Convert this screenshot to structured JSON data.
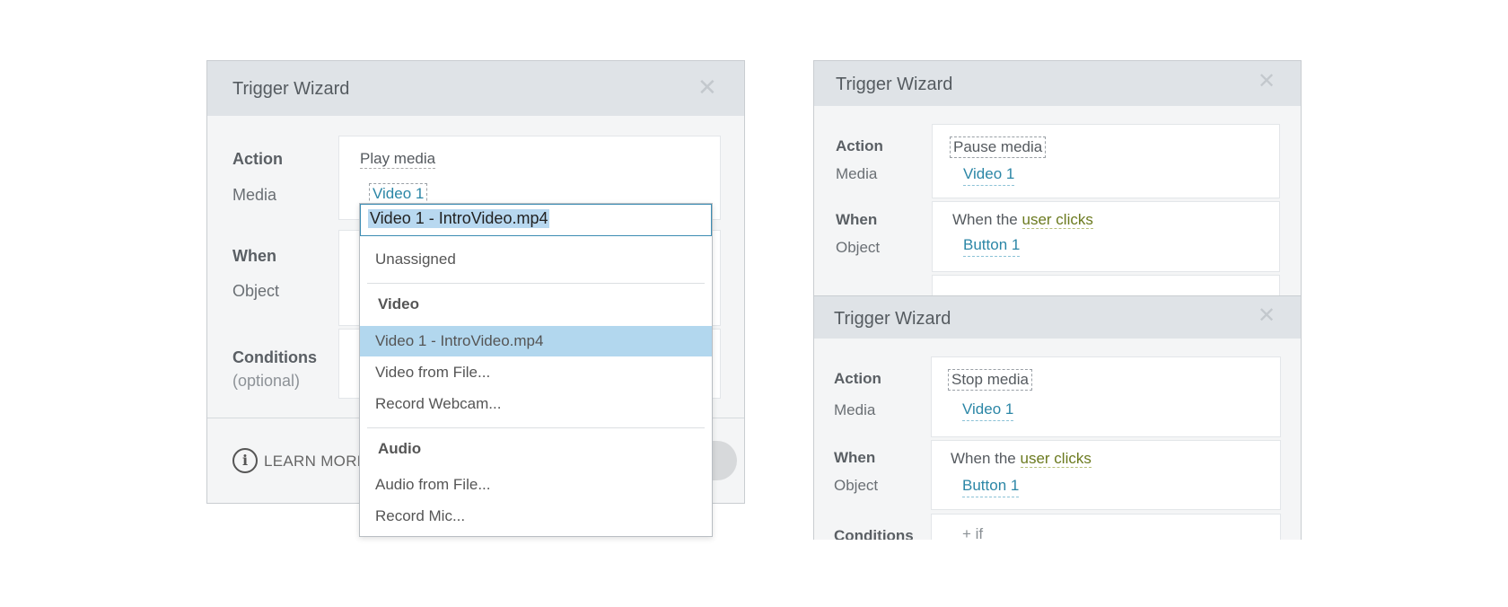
{
  "left": {
    "title": "Trigger Wizard",
    "action_label": "Action",
    "media_label": "Media",
    "action_value": "Play media",
    "media_value": "Video 1",
    "when_label": "When",
    "object_label": "Object",
    "conditions_label": "Conditions",
    "conditions_optional": "(optional)",
    "learn_more": "LEARN MORE",
    "dropdown": {
      "input_value": "Video 1 - IntroVideo.mp4",
      "unassigned": "Unassigned",
      "video_header": "Video",
      "video_items": [
        "Video 1 - IntroVideo.mp4",
        "Video from File...",
        "Record Webcam..."
      ],
      "audio_header": "Audio",
      "audio_items": [
        "Audio from File...",
        "Record Mic..."
      ]
    }
  },
  "right_top": {
    "title": "Trigger Wizard",
    "action_label": "Action",
    "media_label": "Media",
    "action_value": "Pause media",
    "media_value": "Video 1",
    "when_label": "When",
    "object_label": "Object",
    "when_prefix": "When the ",
    "when_event": "user clicks",
    "object_value": "Button 1"
  },
  "right_bottom": {
    "title": "Trigger Wizard",
    "action_label": "Action",
    "media_label": "Media",
    "action_value": "Stop media",
    "media_value": "Video 1",
    "when_label": "When",
    "object_label": "Object",
    "when_prefix": "When the ",
    "when_event": "user clicks",
    "object_value": "Button 1",
    "conditions_label": "Conditions",
    "if_text": "+ if"
  },
  "icons": {
    "close": "close-icon",
    "info": "info-icon"
  },
  "colors": {
    "titlebar": "#dfe3e7",
    "link": "#2b86a6",
    "event": "#6b7a1f",
    "selected": "#b2d7ee"
  }
}
